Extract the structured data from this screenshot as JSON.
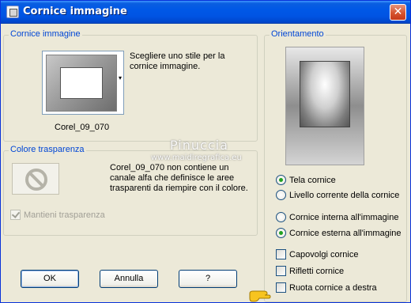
{
  "window": {
    "title": "Cornice immagine",
    "close_glyph": "✕"
  },
  "frame_group": {
    "legend": "Cornice immagine",
    "preview_icon": "frame-thumbnail-icon",
    "dropdown_glyph": "▾",
    "description": "Scegliere uno stile per la cornice immagine.",
    "selected_frame": "Corel_09_070"
  },
  "transparency_group": {
    "legend": "Colore trasparenza",
    "icon": "no-entry-icon",
    "description": "Corel_09_070 non contiene un canale alfa che definisce le aree trasparenti da riempire con il colore.",
    "keep_transparency": {
      "label": "Mantieni trasparenza",
      "checked": true,
      "disabled": true
    }
  },
  "orientation_group": {
    "legend": "Orientamento",
    "radios_target": [
      {
        "label": "Tela cornice",
        "selected": true
      },
      {
        "label": "Livello corrente della cornice",
        "selected": false
      }
    ],
    "radios_side": [
      {
        "label": "Cornice interna all'immagine",
        "selected": false
      },
      {
        "label": "Cornice esterna all'immagine",
        "selected": true
      }
    ],
    "checkboxes": [
      {
        "label": "Capovolgi cornice",
        "checked": false
      },
      {
        "label": "Rifletti cornice",
        "checked": false
      },
      {
        "label": "Ruota cornice a destra",
        "checked": false
      }
    ]
  },
  "buttons": {
    "ok": "OK",
    "cancel": "Annulla",
    "help": "?"
  },
  "watermark": {
    "name": "Pinuccia",
    "site": "www.maidiregrafica.eu"
  },
  "colors": {
    "title_bar": "#0054e3",
    "legend_text": "#0046d5",
    "dialog_bg": "#ece9d8",
    "radio_dot": "#21a121"
  }
}
